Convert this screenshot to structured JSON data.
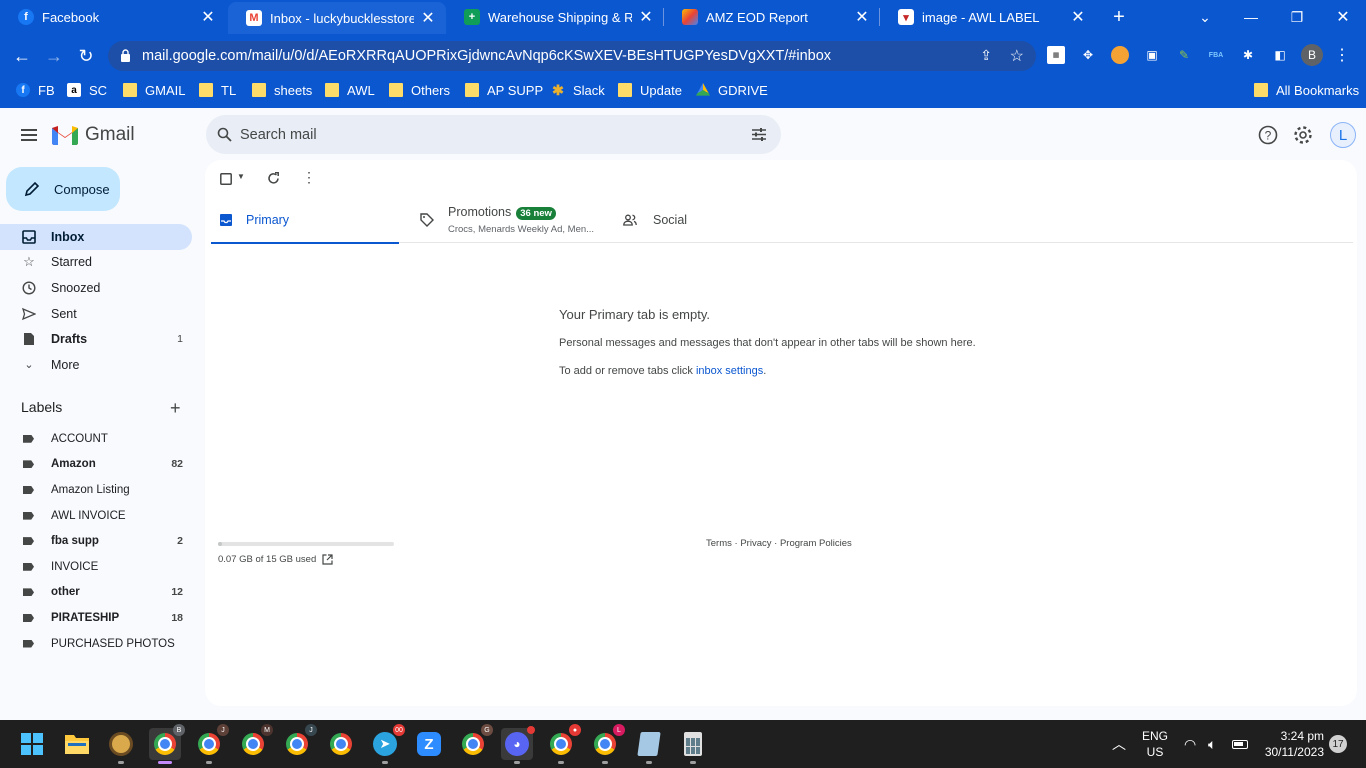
{
  "browser": {
    "tabs": [
      {
        "title": "Facebook",
        "icon": "facebook-icon"
      },
      {
        "title": "Inbox - luckybucklesstore@g",
        "icon": "gmail-icon"
      },
      {
        "title": "Warehouse Shipping & Rece",
        "icon": "sheets-icon"
      },
      {
        "title": "AMZ EOD Report",
        "icon": "report-icon"
      },
      {
        "title": "image - AWL LABEL",
        "icon": "image-icon"
      }
    ],
    "url": "mail.google.com/mail/u/0/d/AEoRXRRqAUOPRixGjdwncAvNqp6cKSwXEV-BEsHTUGPYesDVgXXT/#inbox",
    "profile_initial": "B",
    "bookmarks": [
      {
        "label": "FB",
        "icon": "facebook-icon"
      },
      {
        "label": "SC",
        "icon": "amazon-icon"
      },
      {
        "label": "GMAIL",
        "icon": "folder-icon"
      },
      {
        "label": "TL",
        "icon": "folder-icon"
      },
      {
        "label": "sheets",
        "icon": "folder-icon"
      },
      {
        "label": "AWL",
        "icon": "folder-icon"
      },
      {
        "label": "Others",
        "icon": "folder-icon"
      },
      {
        "label": "AP SUPP",
        "icon": "folder-icon"
      },
      {
        "label": "Slack",
        "icon": "slack-icon"
      },
      {
        "label": "Update",
        "icon": "folder-icon"
      },
      {
        "label": "GDRIVE",
        "icon": "drive-icon"
      }
    ],
    "all_bookmarks": "All Bookmarks"
  },
  "gmail": {
    "logo": "Gmail",
    "search_placeholder": "Search mail",
    "avatar_initial": "L",
    "compose": "Compose",
    "nav": [
      {
        "label": "Inbox",
        "count": "",
        "icon": "inbox-icon"
      },
      {
        "label": "Starred",
        "count": "",
        "icon": "star-icon"
      },
      {
        "label": "Snoozed",
        "count": "",
        "icon": "clock-icon"
      },
      {
        "label": "Sent",
        "count": "",
        "icon": "send-icon"
      },
      {
        "label": "Drafts",
        "count": "1",
        "icon": "draft-icon"
      },
      {
        "label": "More",
        "count": "",
        "icon": "chevron-down-icon"
      }
    ],
    "labels_heading": "Labels",
    "labels": [
      {
        "name": "ACCOUNT",
        "count": ""
      },
      {
        "name": "Amazon",
        "count": "82"
      },
      {
        "name": "Amazon Listing",
        "count": ""
      },
      {
        "name": "AWL INVOICE",
        "count": ""
      },
      {
        "name": "fba supp",
        "count": "2"
      },
      {
        "name": "INVOICE",
        "count": ""
      },
      {
        "name": "other",
        "count": "12"
      },
      {
        "name": "PIRATESHIP",
        "count": "18"
      },
      {
        "name": "PURCHASED PHOTOS",
        "count": ""
      }
    ],
    "tabs": {
      "primary": "Primary",
      "promotions": "Promotions",
      "promotions_badge": "36 new",
      "promotions_sub": "Crocs, Menards Weekly Ad, Men...",
      "social": "Social"
    },
    "empty": {
      "title": "Your Primary tab is empty.",
      "line1": "Personal messages and messages that don't appear in other tabs will be shown here.",
      "line2_prefix": "To add or remove tabs click ",
      "line2_link": "inbox settings",
      "line2_suffix": "."
    },
    "storage": {
      "text": "0.07 GB of 15 GB used",
      "fraction": 0.005
    },
    "footer": {
      "terms": "Terms",
      "privacy": "Privacy",
      "policies": "Program Policies"
    }
  },
  "taskbar": {
    "lang": "ENG",
    "region": "US",
    "time": "3:24 pm",
    "date": "30/11/2023",
    "notifications": "17",
    "telegram_badge": "00"
  }
}
